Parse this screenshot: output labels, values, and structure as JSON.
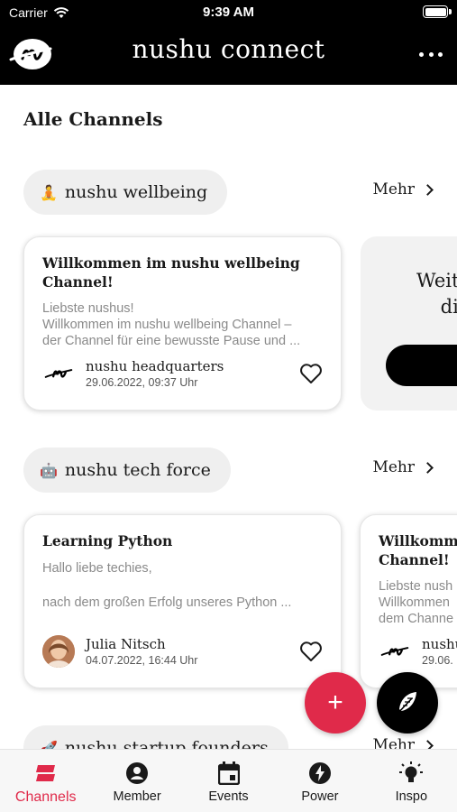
{
  "status_bar": {
    "carrier": "Carrier",
    "time": "9:39 AM"
  },
  "header": {
    "title": "nushu connect"
  },
  "main": {
    "section_title": "Alle Channels",
    "more_label": "Mehr",
    "channels": [
      {
        "name": "nushu wellbeing",
        "emoji": "🧘",
        "posts": [
          {
            "title": "Willkommen im nushu wellbeing Channel!",
            "body_lines": [
              "Liebste nushus!",
              "Willkommen im nushu wellbeing Channel –",
              "der Channel für eine bewusste Pause und ..."
            ],
            "author": "nushu headquarters",
            "date": "29.06.2022, 09:37 Uhr"
          }
        ],
        "promo_lines": [
          "Weit",
          "di"
        ]
      },
      {
        "name": "nushu tech force",
        "emoji": "🤖",
        "posts": [
          {
            "title": "Learning Python",
            "body_lines": [
              "Hallo liebe techies,",
              "",
              "nach dem großen Erfolg unseres Python ..."
            ],
            "author": "Julia Nitsch",
            "date": "04.07.2022, 16:44 Uhr"
          },
          {
            "title_lines": [
              "Willkomm",
              "Channel!"
            ],
            "body_lines": [
              "Liebste nush",
              "Willkommen",
              "dem Channe"
            ],
            "author": "nushu",
            "date": "29.06."
          }
        ]
      },
      {
        "name": "nushu startup founders",
        "emoji": "🚀"
      }
    ]
  },
  "fab": {
    "add_label": "+"
  },
  "tabbar": {
    "items": [
      {
        "label": "Channels",
        "icon": "channels-icon",
        "active": true
      },
      {
        "label": "Member",
        "icon": "member-icon"
      },
      {
        "label": "Events",
        "icon": "calendar-icon"
      },
      {
        "label": "Power",
        "icon": "bolt-icon"
      },
      {
        "label": "Inspo",
        "icon": "lightbulb-icon"
      }
    ]
  },
  "colors": {
    "accent": "#e02a4a",
    "header_bg": "#000000",
    "pill_bg": "#efefef"
  }
}
